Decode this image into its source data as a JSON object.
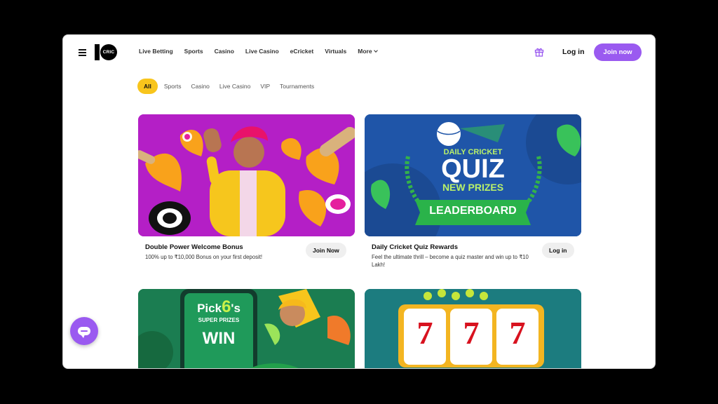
{
  "header": {
    "logo_text": "CRIC",
    "nav": [
      "Live Betting",
      "Sports",
      "Casino",
      "Live Casino",
      "eCricket",
      "Virtuals",
      "More"
    ],
    "login_label": "Log in",
    "join_label": "Join now"
  },
  "filters": [
    "All",
    "Sports",
    "Casino",
    "Live Casino",
    "VIP",
    "Tournaments"
  ],
  "promos": [
    {
      "title": "Double Power Welcome Bonus",
      "description": "100% up to ₹10,000 Bonus on your first deposit!",
      "button": "Join Now"
    },
    {
      "title": "Daily Cricket Quiz Rewards",
      "description": "Feel the ultimate thrill – become a quiz master and win up to ₹10 Lakh!",
      "button": "Log in",
      "banner": {
        "line1": "DAILY CRICKET",
        "line2": "QUIZ",
        "line3": "NEW PRIZES",
        "ribbon": "LEADERBOARD"
      }
    },
    {
      "banner": {
        "line1": "Pick",
        "digit": "6",
        "line1b": "'s",
        "line2": "SUPER PRIZES",
        "line3": "WIN"
      }
    },
    {
      "banner": {
        "reels": [
          "7",
          "7",
          "7"
        ]
      }
    }
  ],
  "colors": {
    "accent": "#9a5af0",
    "chip_active": "#f8c51c"
  }
}
